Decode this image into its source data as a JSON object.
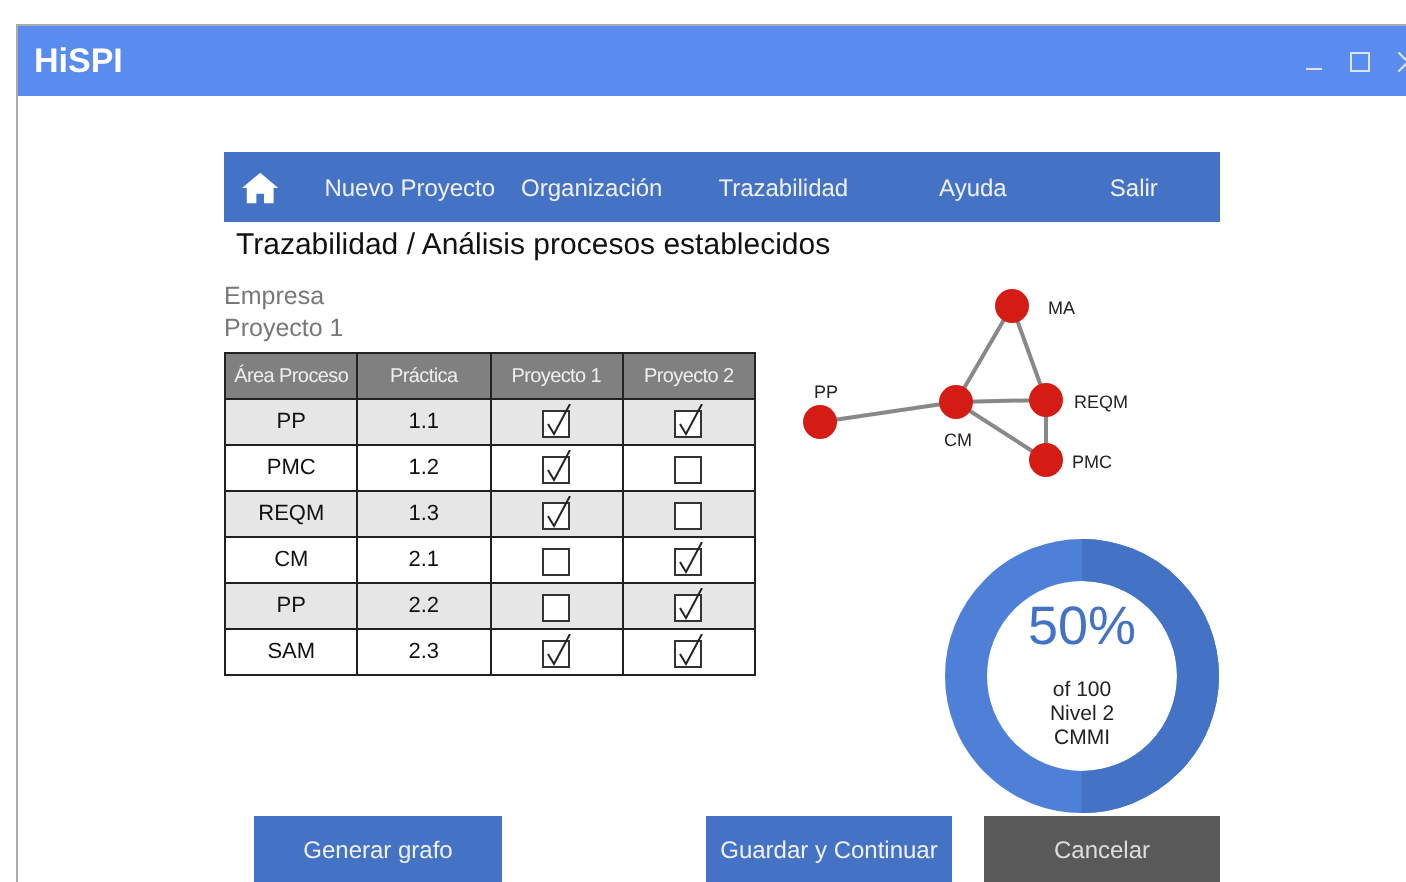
{
  "window": {
    "title": "HiSPI"
  },
  "nav": {
    "items": [
      {
        "label": "Nuevo Proyecto"
      },
      {
        "label": "Organización"
      },
      {
        "label": "Trazabilidad"
      },
      {
        "label": "Ayuda"
      },
      {
        "label": "Salir"
      }
    ]
  },
  "heading": "Trazabilidad / Análisis procesos establecidos",
  "company": "Empresa",
  "project": "Proyecto 1",
  "table": {
    "columns": [
      "Área Proceso",
      "Práctica",
      "Proyecto 1",
      "Proyecto 2"
    ],
    "rows": [
      {
        "area": "PP",
        "practice": "1.1",
        "p1": true,
        "p2": true
      },
      {
        "area": "PMC",
        "practice": "1.2",
        "p1": true,
        "p2": false
      },
      {
        "area": "REQM",
        "practice": "1.3",
        "p1": true,
        "p2": false
      },
      {
        "area": "CM",
        "practice": "2.1",
        "p1": false,
        "p2": true
      },
      {
        "area": "PP",
        "practice": "2.2",
        "p1": false,
        "p2": true
      },
      {
        "area": "SAM",
        "practice": "2.3",
        "p1": true,
        "p2": true
      }
    ]
  },
  "graph": {
    "nodes": [
      {
        "label": "MA"
      },
      {
        "label": "PP"
      },
      {
        "label": "CM"
      },
      {
        "label": "REQM"
      },
      {
        "label": "PMC"
      }
    ]
  },
  "gauge": {
    "value": "50%",
    "level": 0.5,
    "lines": [
      "of 100",
      "Nivel 2",
      "CMMI"
    ]
  },
  "buttons": [
    {
      "label": "Generar grafo",
      "kind": "primary"
    },
    {
      "label": "Guardar y Continuar",
      "kind": "primary"
    },
    {
      "label": "Cancelar",
      "kind": "secondary"
    }
  ]
}
